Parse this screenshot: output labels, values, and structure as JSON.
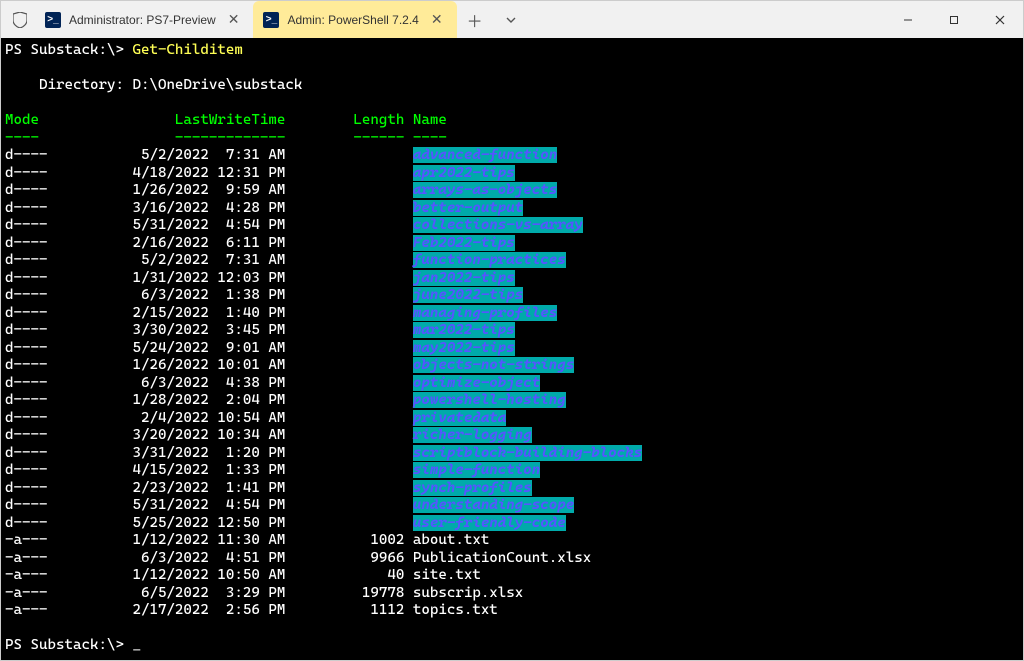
{
  "window": {
    "tabs": [
      {
        "icon": ">_",
        "title": "Administrator: PS7-Preview",
        "active": false
      },
      {
        "icon": ">_",
        "title": "Admin: PowerShell 7.2.4",
        "active": true
      }
    ]
  },
  "prompt1_path": "PS Substack:\\> ",
  "prompt1_cmd": "Get-Childitem",
  "directory_label": "    Directory: ",
  "directory_path": "D:\\OneDrive\\substack",
  "headers": {
    "mode": "Mode",
    "lastwrite": "LastWriteTime",
    "length": "Length",
    "name": "Name",
    "mode_ul": "----",
    "lastwrite_ul": "-------------",
    "length_ul": "------",
    "name_ul": "----"
  },
  "rows": [
    {
      "mode": "d----",
      "date": "5/2/2022",
      "time": "7:31 AM",
      "length": "",
      "name": "advanced-function",
      "dir": true
    },
    {
      "mode": "d----",
      "date": "4/18/2022",
      "time": "12:31 PM",
      "length": "",
      "name": "apr2022-tips",
      "dir": true
    },
    {
      "mode": "d----",
      "date": "1/26/2022",
      "time": "9:59 AM",
      "length": "",
      "name": "arrays-as-objects",
      "dir": true
    },
    {
      "mode": "d----",
      "date": "3/16/2022",
      "time": "4:28 PM",
      "length": "",
      "name": "better-output",
      "dir": true
    },
    {
      "mode": "d----",
      "date": "5/31/2022",
      "time": "4:54 PM",
      "length": "",
      "name": "collections-vs-array",
      "dir": true
    },
    {
      "mode": "d----",
      "date": "2/16/2022",
      "time": "6:11 PM",
      "length": "",
      "name": "Feb2022-tips",
      "dir": true
    },
    {
      "mode": "d----",
      "date": "5/2/2022",
      "time": "7:31 AM",
      "length": "",
      "name": "function-practices",
      "dir": true
    },
    {
      "mode": "d----",
      "date": "1/31/2022",
      "time": "12:03 PM",
      "length": "",
      "name": "jan2022-tips",
      "dir": true
    },
    {
      "mode": "d----",
      "date": "6/3/2022",
      "time": "1:38 PM",
      "length": "",
      "name": "june2022-tips",
      "dir": true
    },
    {
      "mode": "d----",
      "date": "2/15/2022",
      "time": "1:40 PM",
      "length": "",
      "name": "managing-profiles",
      "dir": true
    },
    {
      "mode": "d----",
      "date": "3/30/2022",
      "time": "3:45 PM",
      "length": "",
      "name": "mar2022-tips",
      "dir": true
    },
    {
      "mode": "d----",
      "date": "5/24/2022",
      "time": "9:01 AM",
      "length": "",
      "name": "may2022-tips",
      "dir": true
    },
    {
      "mode": "d----",
      "date": "1/26/2022",
      "time": "10:01 AM",
      "length": "",
      "name": "objects-not-strings",
      "dir": true
    },
    {
      "mode": "d----",
      "date": "6/3/2022",
      "time": "4:38 PM",
      "length": "",
      "name": "optimize-object",
      "dir": true
    },
    {
      "mode": "d----",
      "date": "1/28/2022",
      "time": "2:04 PM",
      "length": "",
      "name": "powershell-hosting",
      "dir": true
    },
    {
      "mode": "d----",
      "date": "2/4/2022",
      "time": "10:54 AM",
      "length": "",
      "name": "privatedata",
      "dir": true
    },
    {
      "mode": "d----",
      "date": "3/20/2022",
      "time": "10:34 AM",
      "length": "",
      "name": "richer-logging",
      "dir": true
    },
    {
      "mode": "d----",
      "date": "3/31/2022",
      "time": "1:20 PM",
      "length": "",
      "name": "scriptblock-building-blocks",
      "dir": true
    },
    {
      "mode": "d----",
      "date": "4/15/2022",
      "time": "1:33 PM",
      "length": "",
      "name": "simple-function",
      "dir": true
    },
    {
      "mode": "d----",
      "date": "2/23/2022",
      "time": "1:41 PM",
      "length": "",
      "name": "synch-profiles",
      "dir": true
    },
    {
      "mode": "d----",
      "date": "5/31/2022",
      "time": "4:54 PM",
      "length": "",
      "name": "understanding-scope",
      "dir": true
    },
    {
      "mode": "d----",
      "date": "5/25/2022",
      "time": "12:50 PM",
      "length": "",
      "name": "user-friendly-code",
      "dir": true
    },
    {
      "mode": "-a---",
      "date": "1/12/2022",
      "time": "11:30 AM",
      "length": "1002",
      "name": "about.txt",
      "dir": false
    },
    {
      "mode": "-a---",
      "date": "6/3/2022",
      "time": "4:51 PM",
      "length": "9966",
      "name": "PublicationCount.xlsx",
      "dir": false
    },
    {
      "mode": "-a---",
      "date": "1/12/2022",
      "time": "10:50 AM",
      "length": "40",
      "name": "site.txt",
      "dir": false
    },
    {
      "mode": "-a---",
      "date": "6/5/2022",
      "time": "3:29 PM",
      "length": "19778",
      "name": "subscrip.xlsx",
      "dir": false
    },
    {
      "mode": "-a---",
      "date": "2/17/2022",
      "time": "2:56 PM",
      "length": "1112",
      "name": "topics.txt",
      "dir": false
    }
  ],
  "prompt2_path": "PS Substack:\\> "
}
